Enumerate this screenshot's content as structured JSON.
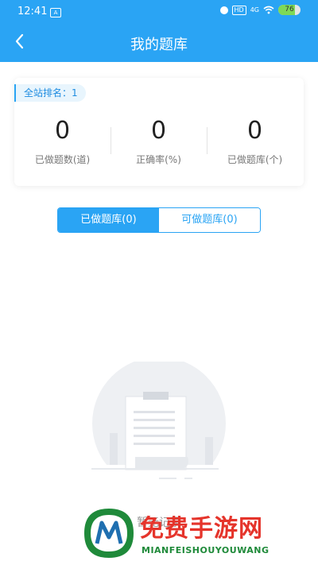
{
  "status_bar": {
    "time": "12:41",
    "hd": "HD",
    "network": "4G",
    "battery": "76"
  },
  "navbar": {
    "title": "我的题库"
  },
  "stats": {
    "rank_label": "全站排名：1",
    "items": [
      {
        "value": "0",
        "label": "已做题数(道)"
      },
      {
        "value": "0",
        "label": "正确率(%)"
      },
      {
        "value": "0",
        "label": "已做题库(个)"
      }
    ]
  },
  "tabs": [
    {
      "label": "已做题库(0)",
      "active": true
    },
    {
      "label": "可做题库(0)",
      "active": false
    }
  ],
  "empty_state": {
    "text": "暂无记录"
  },
  "watermark": {
    "text": "免费手游网",
    "sub": "MIANFEISHOUYOUWANG"
  },
  "colors": {
    "accent": "#2aa4f4",
    "watermark_red": "#e5342b",
    "watermark_green": "#1f8a3a"
  }
}
